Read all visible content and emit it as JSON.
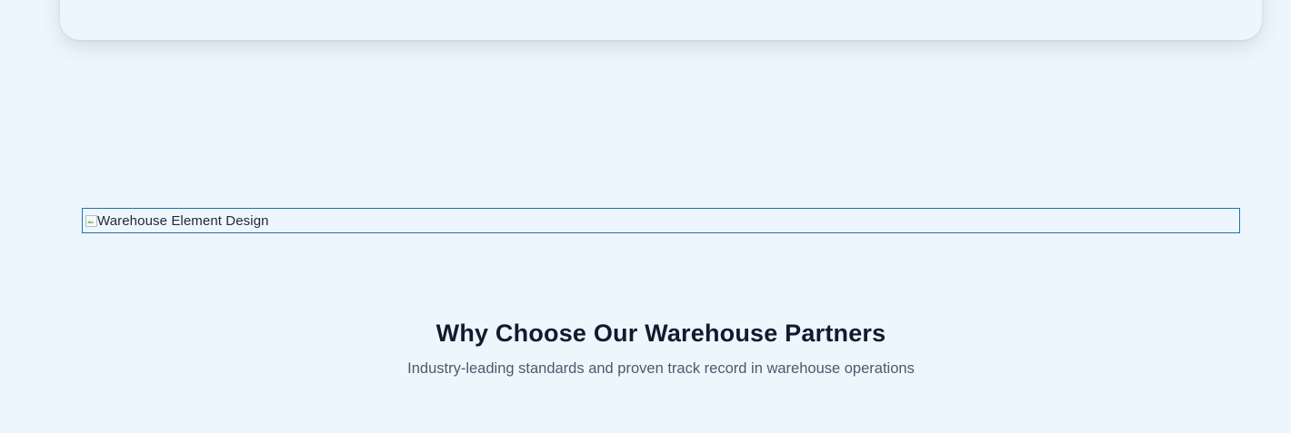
{
  "broken_image": {
    "alt": "Warehouse Element Design"
  },
  "section": {
    "title": "Why Choose Our Warehouse Partners",
    "subtitle": "Industry-leading standards and proven track record in warehouse operations"
  },
  "colors": {
    "background": "#eef6fd",
    "title": "#111a2e",
    "subtitle": "#4b5a6e",
    "image_border": "#1a74ad"
  }
}
